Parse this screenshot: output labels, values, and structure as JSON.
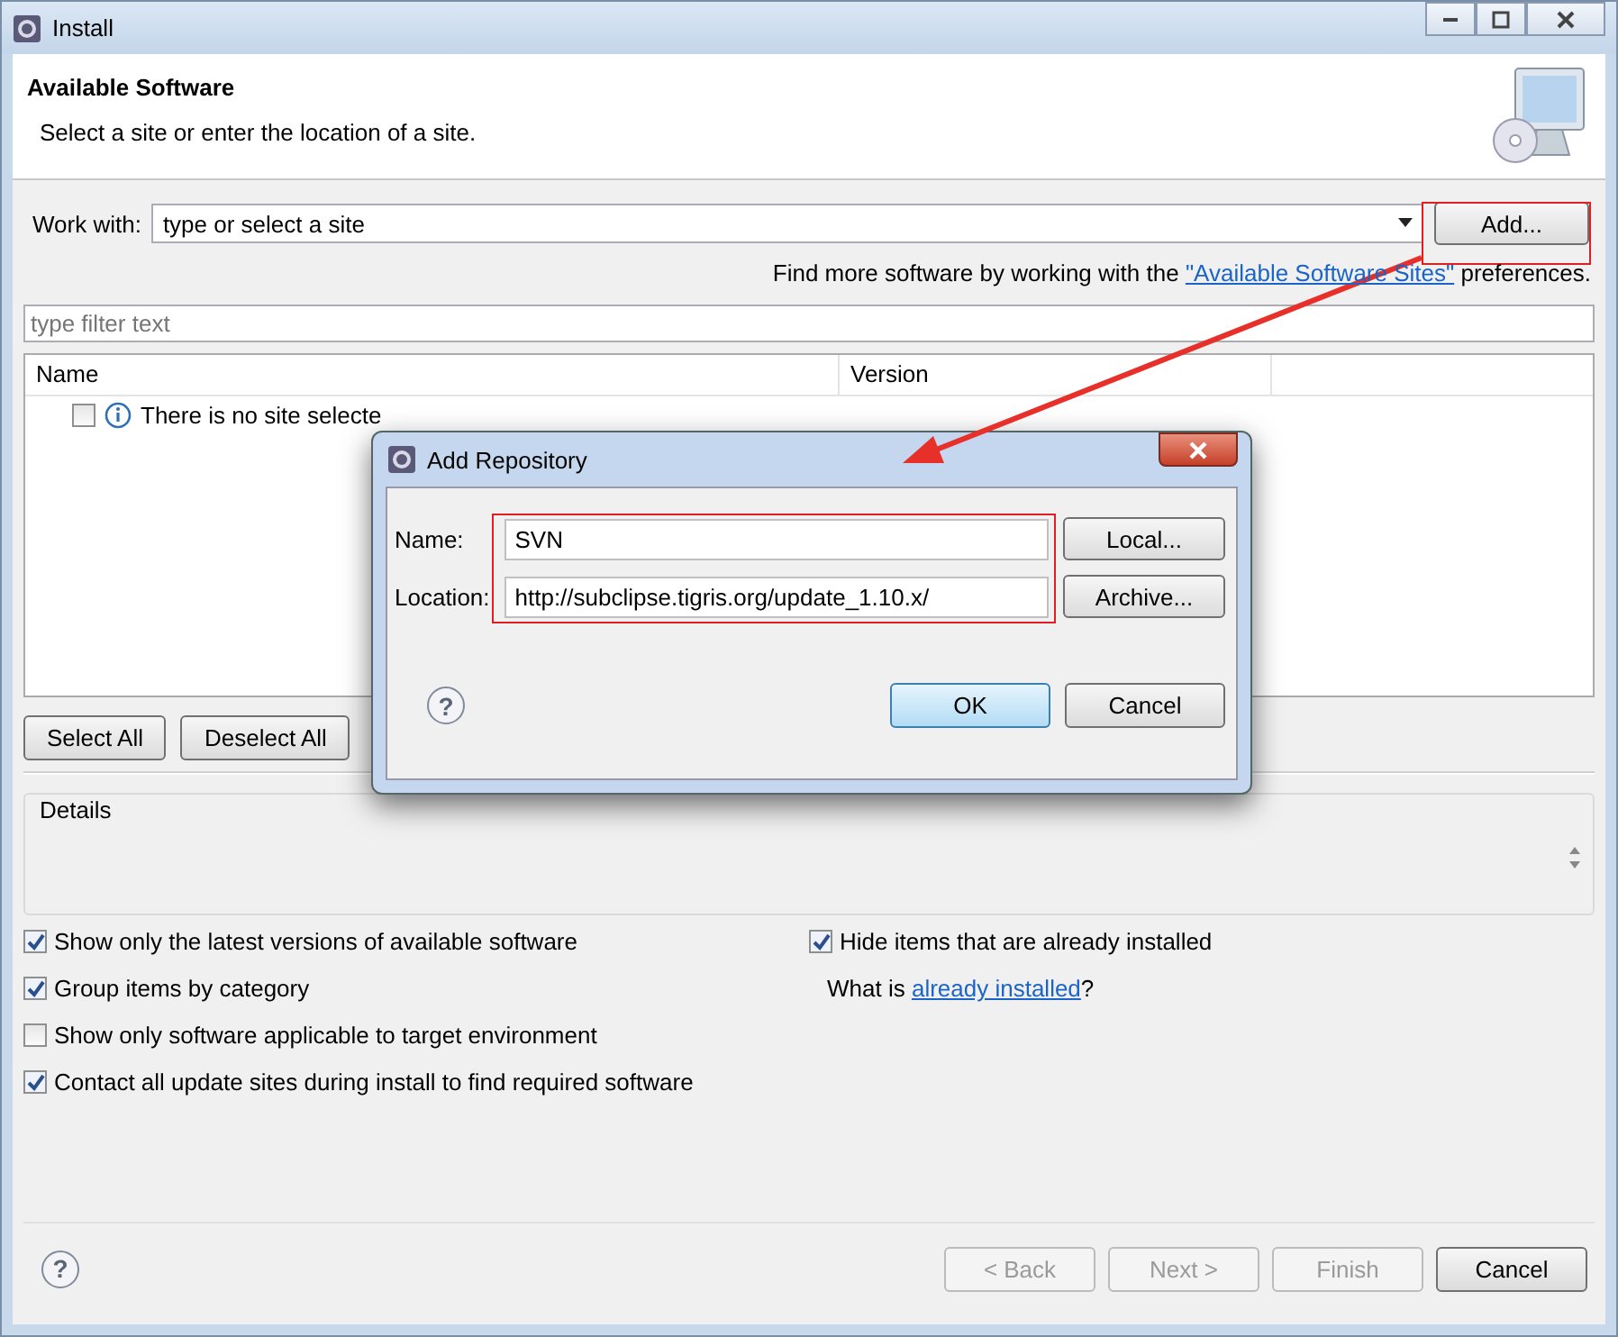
{
  "window": {
    "title": "Install"
  },
  "header": {
    "title": "Available Software",
    "subtitle": "Select a site or enter the location of a site."
  },
  "work_with": {
    "label": "Work with:",
    "placeholder": "type or select a site",
    "button": "Add..."
  },
  "hint": {
    "before": "Find more software by working with the ",
    "link": "\"Available Software Sites\"",
    "after": " preferences."
  },
  "filter": {
    "placeholder": "type filter text"
  },
  "table": {
    "columns": [
      "Name",
      "Version"
    ],
    "rows": [
      {
        "text": "There is no site selecte",
        "checked": false
      }
    ]
  },
  "selection_buttons": [
    "Select All",
    "Deselect All"
  ],
  "details": {
    "label": "Details"
  },
  "options_left": [
    {
      "label": "Show only the latest versions of available software",
      "checked": true
    },
    {
      "label": "Group items by category",
      "checked": true
    },
    {
      "label": "Show only software applicable to target environment",
      "checked": false
    },
    {
      "label": "Contact all update sites during install to find required software",
      "checked": true
    }
  ],
  "options_right": {
    "checkbox": {
      "label": "Hide items that are already installed",
      "checked": true
    },
    "note": {
      "before": "What is ",
      "link": "already installed",
      "after": "?"
    }
  },
  "footer": {
    "help_icon": "?",
    "buttons": [
      {
        "label": "< Back",
        "disabled": true
      },
      {
        "label": "Next >",
        "disabled": true
      },
      {
        "label": "Finish",
        "disabled": true
      },
      {
        "label": "Cancel",
        "disabled": false
      }
    ]
  },
  "dialog": {
    "title": "Add Repository",
    "help_icon": "?",
    "fields": [
      {
        "label": "Name:",
        "value": "SVN",
        "button": "Local..."
      },
      {
        "label": "Location:",
        "value": "http://subclipse.tigris.org/update_1.10.x/",
        "button": "Archive..."
      }
    ],
    "buttons": [
      {
        "label": "OK",
        "default": true
      },
      {
        "label": "Cancel",
        "default": false
      }
    ]
  }
}
